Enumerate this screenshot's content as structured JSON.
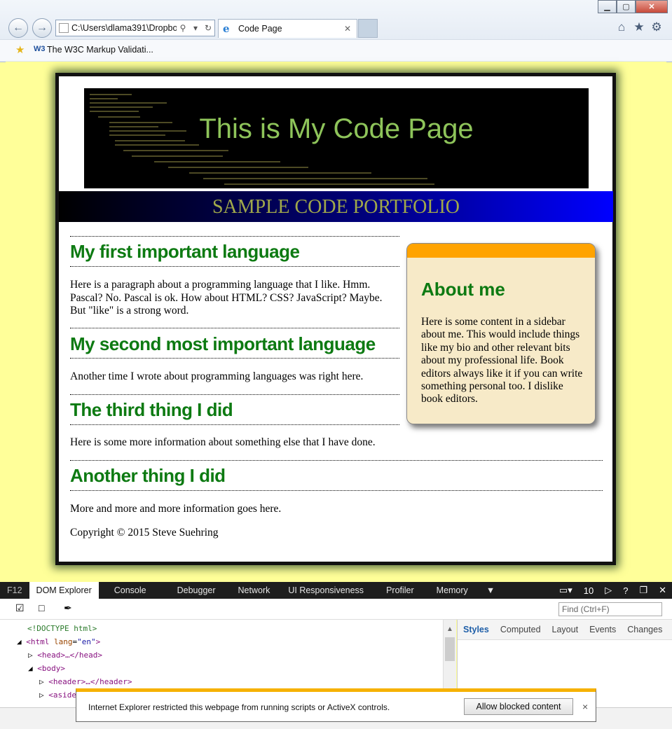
{
  "browser": {
    "address": "C:\\Users\\dlama391\\Dropbox",
    "tab_title": "Code Page",
    "favorite": "The W3C Markup Validati...",
    "favorite_badge": "W3",
    "window_buttons": {
      "min": "▁",
      "max": "▢",
      "close": "✕"
    },
    "icons": [
      "back-arrow-icon",
      "forward-arrow-icon",
      "search-icon",
      "refresh-icon",
      "home-icon",
      "star-icon",
      "gear-icon"
    ]
  },
  "page": {
    "banner_title": "This is My Code Page",
    "subtitle": "SAMPLE CODE PORTFOLIO",
    "sections": [
      {
        "heading": "My first important language",
        "text": "Here is a paragraph about a programming language that I like. Hmm. Pascal? No. Pascal is ok. How about HTML? CSS? JavaScript? Maybe. But \"like\" is a strong word."
      },
      {
        "heading": "My second most important language",
        "text": "Another time I wrote about programming languages was right here."
      },
      {
        "heading": "The third thing I did",
        "text": "Here is some more information about something else that I have done."
      },
      {
        "heading": "Another thing I did",
        "text": "More and more and more information goes here."
      }
    ],
    "copyright": "Copyright © 2015 Steve Suehring",
    "aside": {
      "heading": "About me",
      "text": "Here is some content in a sidebar about me. This would include things like my bio and other relevant bits about my professional life. Book editors always like it if you can write something personal too. I dislike book editors."
    },
    "colors": {
      "background": "#ffff99",
      "heading": "#0d7a12",
      "aside_bg": "#f7eac8",
      "aside_top": "#ffa300",
      "banner_text": "#8ec45a",
      "subtitle": "#a0a84a"
    }
  },
  "devtools": {
    "tabs": [
      "F12",
      "DOM Explorer",
      "Console",
      "Debugger",
      "Network",
      "UI Responsiveness",
      "Profiler",
      "Memory"
    ],
    "active_tab": "DOM Explorer",
    "emulation_value": "10",
    "find_placeholder": "Find (Ctrl+F)",
    "style_tabs": [
      "Styles",
      "Computed",
      "Layout",
      "Events",
      "Changes"
    ],
    "dom": {
      "doctype": "<!DOCTYPE html>",
      "html_open": "<html",
      "lang_attr": "lang",
      "lang_val": "\"en\"",
      "head": "<head>…</head>",
      "body": "<body>",
      "header": "<header>…</header>",
      "aside": "<aside"
    }
  },
  "notification": {
    "message": "Internet Explorer restricted this webpage from running scripts or ActiveX controls.",
    "button": "Allow blocked content",
    "close": "×"
  }
}
